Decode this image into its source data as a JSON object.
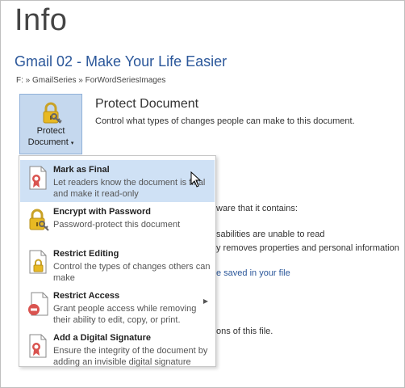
{
  "page": {
    "title": "Info",
    "doc_title": "Gmail 02 - Make Your Life Easier",
    "doc_path": "F: » GmailSeries » ForWordSeriesImages"
  },
  "protect": {
    "button_label_line1": "Protect",
    "button_label_line2": "Document",
    "section_title": "Protect Document",
    "section_desc": "Control what types of changes people can make to this document."
  },
  "background_text": {
    "aware": "ware that it contains:",
    "disabilities": "sabilities are unable to read",
    "removes": "y removes properties and personal information",
    "saved": "e saved in your file",
    "versions": "ons of this file."
  },
  "menu": {
    "items": [
      {
        "title": "Mark as Final",
        "desc": "Let readers know the document is final and make it read-only",
        "icon": "ribbon-document-icon"
      },
      {
        "title": "Encrypt with Password",
        "desc": "Password-protect this document",
        "icon": "lock-key-icon"
      },
      {
        "title": "Restrict Editing",
        "desc": "Control the types of changes others can make",
        "icon": "lock-document-icon"
      },
      {
        "title": "Restrict Access",
        "desc": "Grant people access while removing their ability to edit, copy, or print.",
        "icon": "restrict-document-icon"
      },
      {
        "title": "Add a Digital Signature",
        "desc": "Ensure the integrity of the document by adding an invisible digital signature",
        "icon": "signature-document-icon"
      }
    ]
  },
  "colors": {
    "accent": "#2b579a",
    "button_bg": "#c5d8ee",
    "highlight": "#cfe1f5"
  }
}
